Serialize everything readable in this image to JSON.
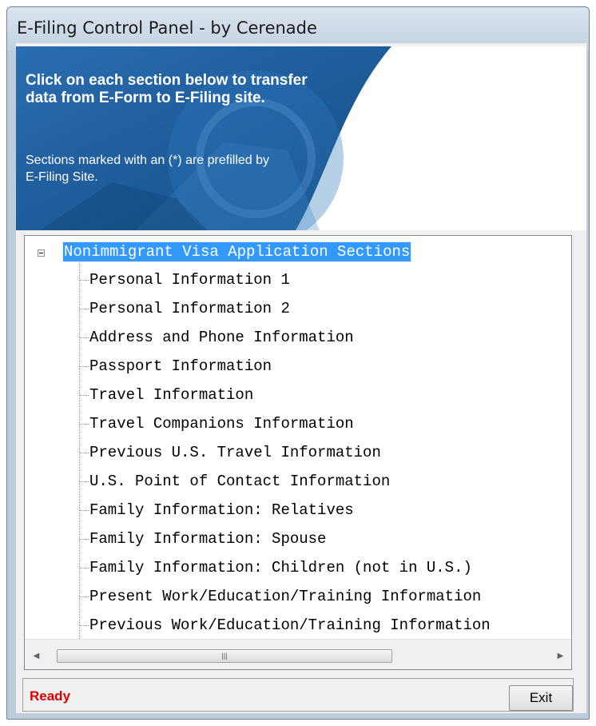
{
  "window": {
    "title": "E-Filing Control Panel - by Cerenade"
  },
  "banner": {
    "title": "Click on each section below to transfer data from E-Form to E-Filing site.",
    "note": "Sections marked with an (*) are prefilled by E-Filing Site."
  },
  "tree": {
    "root_label": "Nonimmigrant Visa Application Sections",
    "items": [
      {
        "label": "Personal Information 1"
      },
      {
        "label": "Personal Information 2"
      },
      {
        "label": "Address and Phone Information"
      },
      {
        "label": "Passport Information"
      },
      {
        "label": "Travel Information"
      },
      {
        "label": "Travel Companions Information"
      },
      {
        "label": "Previous U.S. Travel Information"
      },
      {
        "label": "U.S. Point of Contact Information"
      },
      {
        "label": "Family Information: Relatives"
      },
      {
        "label": "Family Information: Spouse"
      },
      {
        "label": "Family Information: Children (not in U.S.)"
      },
      {
        "label": "Present Work/Education/Training Information"
      },
      {
        "label": "Previous Work/Education/Training Information"
      }
    ]
  },
  "status": {
    "text": "Ready",
    "exit_label": "Exit"
  },
  "colors": {
    "selection": "#3399ff",
    "status_text": "#e00000",
    "banner_blue": "#1f5f9e"
  },
  "icons": {
    "expander": "minus-box-icon",
    "scroll_up": "arrow-up-icon",
    "scroll_down": "arrow-down-icon",
    "scroll_left": "arrow-left-icon",
    "scroll_right": "arrow-right-icon"
  }
}
